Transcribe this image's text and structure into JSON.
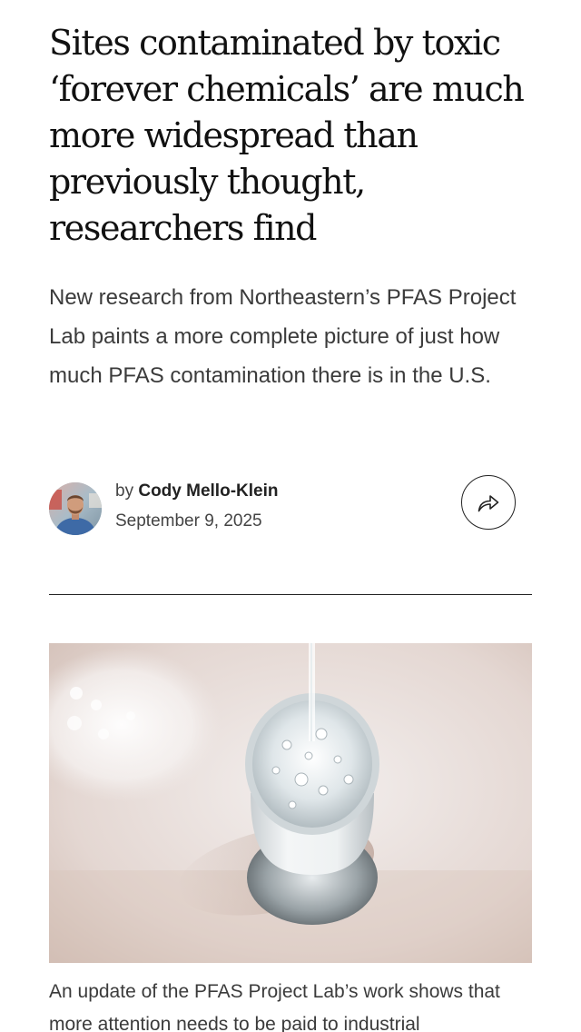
{
  "article": {
    "headline": "Sites contaminated by toxic ‘forever chemicals’ are much more widespread than previously thought, researchers find",
    "dek": "New research from Northeastern’s PFAS Project Lab paints a more complete picture of just how much PFAS contamination there is in the U.S.",
    "byline": {
      "prefix": "by",
      "author": "Cody Mello-Klein",
      "date": "September 9, 2025"
    },
    "share_icon": "share-arrow-icon",
    "hero_image": {
      "subject": "glass of water being poured"
    },
    "caption": "An update of the PFAS Project Lab’s work shows that more attention needs to be paid to industrial"
  },
  "colors": {
    "text": "#111111",
    "body_text": "#3b3b3b",
    "rule": "#222222",
    "background": "#ffffff"
  }
}
